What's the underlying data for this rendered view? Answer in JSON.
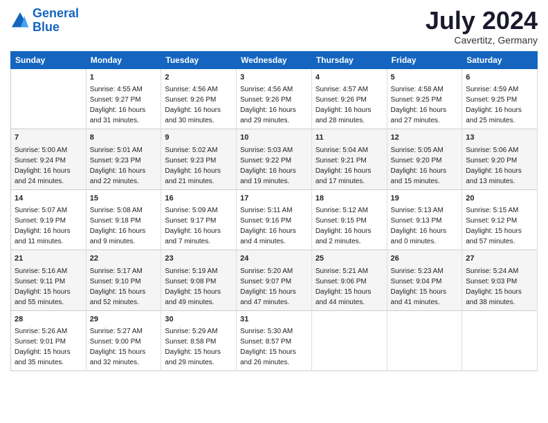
{
  "header": {
    "logo_line1": "General",
    "logo_line2": "Blue",
    "title": "July 2024",
    "subtitle": "Cavertitz, Germany"
  },
  "weekdays": [
    "Sunday",
    "Monday",
    "Tuesday",
    "Wednesday",
    "Thursday",
    "Friday",
    "Saturday"
  ],
  "weeks": [
    [
      {
        "day": "",
        "content": ""
      },
      {
        "day": "1",
        "content": "Sunrise: 4:55 AM\nSunset: 9:27 PM\nDaylight: 16 hours\nand 31 minutes."
      },
      {
        "day": "2",
        "content": "Sunrise: 4:56 AM\nSunset: 9:26 PM\nDaylight: 16 hours\nand 30 minutes."
      },
      {
        "day": "3",
        "content": "Sunrise: 4:56 AM\nSunset: 9:26 PM\nDaylight: 16 hours\nand 29 minutes."
      },
      {
        "day": "4",
        "content": "Sunrise: 4:57 AM\nSunset: 9:26 PM\nDaylight: 16 hours\nand 28 minutes."
      },
      {
        "day": "5",
        "content": "Sunrise: 4:58 AM\nSunset: 9:25 PM\nDaylight: 16 hours\nand 27 minutes."
      },
      {
        "day": "6",
        "content": "Sunrise: 4:59 AM\nSunset: 9:25 PM\nDaylight: 16 hours\nand 25 minutes."
      }
    ],
    [
      {
        "day": "7",
        "content": "Sunrise: 5:00 AM\nSunset: 9:24 PM\nDaylight: 16 hours\nand 24 minutes."
      },
      {
        "day": "8",
        "content": "Sunrise: 5:01 AM\nSunset: 9:23 PM\nDaylight: 16 hours\nand 22 minutes."
      },
      {
        "day": "9",
        "content": "Sunrise: 5:02 AM\nSunset: 9:23 PM\nDaylight: 16 hours\nand 21 minutes."
      },
      {
        "day": "10",
        "content": "Sunrise: 5:03 AM\nSunset: 9:22 PM\nDaylight: 16 hours\nand 19 minutes."
      },
      {
        "day": "11",
        "content": "Sunrise: 5:04 AM\nSunset: 9:21 PM\nDaylight: 16 hours\nand 17 minutes."
      },
      {
        "day": "12",
        "content": "Sunrise: 5:05 AM\nSunset: 9:20 PM\nDaylight: 16 hours\nand 15 minutes."
      },
      {
        "day": "13",
        "content": "Sunrise: 5:06 AM\nSunset: 9:20 PM\nDaylight: 16 hours\nand 13 minutes."
      }
    ],
    [
      {
        "day": "14",
        "content": "Sunrise: 5:07 AM\nSunset: 9:19 PM\nDaylight: 16 hours\nand 11 minutes."
      },
      {
        "day": "15",
        "content": "Sunrise: 5:08 AM\nSunset: 9:18 PM\nDaylight: 16 hours\nand 9 minutes."
      },
      {
        "day": "16",
        "content": "Sunrise: 5:09 AM\nSunset: 9:17 PM\nDaylight: 16 hours\nand 7 minutes."
      },
      {
        "day": "17",
        "content": "Sunrise: 5:11 AM\nSunset: 9:16 PM\nDaylight: 16 hours\nand 4 minutes."
      },
      {
        "day": "18",
        "content": "Sunrise: 5:12 AM\nSunset: 9:15 PM\nDaylight: 16 hours\nand 2 minutes."
      },
      {
        "day": "19",
        "content": "Sunrise: 5:13 AM\nSunset: 9:13 PM\nDaylight: 16 hours\nand 0 minutes."
      },
      {
        "day": "20",
        "content": "Sunrise: 5:15 AM\nSunset: 9:12 PM\nDaylight: 15 hours\nand 57 minutes."
      }
    ],
    [
      {
        "day": "21",
        "content": "Sunrise: 5:16 AM\nSunset: 9:11 PM\nDaylight: 15 hours\nand 55 minutes."
      },
      {
        "day": "22",
        "content": "Sunrise: 5:17 AM\nSunset: 9:10 PM\nDaylight: 15 hours\nand 52 minutes."
      },
      {
        "day": "23",
        "content": "Sunrise: 5:19 AM\nSunset: 9:08 PM\nDaylight: 15 hours\nand 49 minutes."
      },
      {
        "day": "24",
        "content": "Sunrise: 5:20 AM\nSunset: 9:07 PM\nDaylight: 15 hours\nand 47 minutes."
      },
      {
        "day": "25",
        "content": "Sunrise: 5:21 AM\nSunset: 9:06 PM\nDaylight: 15 hours\nand 44 minutes."
      },
      {
        "day": "26",
        "content": "Sunrise: 5:23 AM\nSunset: 9:04 PM\nDaylight: 15 hours\nand 41 minutes."
      },
      {
        "day": "27",
        "content": "Sunrise: 5:24 AM\nSunset: 9:03 PM\nDaylight: 15 hours\nand 38 minutes."
      }
    ],
    [
      {
        "day": "28",
        "content": "Sunrise: 5:26 AM\nSunset: 9:01 PM\nDaylight: 15 hours\nand 35 minutes."
      },
      {
        "day": "29",
        "content": "Sunrise: 5:27 AM\nSunset: 9:00 PM\nDaylight: 15 hours\nand 32 minutes."
      },
      {
        "day": "30",
        "content": "Sunrise: 5:29 AM\nSunset: 8:58 PM\nDaylight: 15 hours\nand 29 minutes."
      },
      {
        "day": "31",
        "content": "Sunrise: 5:30 AM\nSunset: 8:57 PM\nDaylight: 15 hours\nand 26 minutes."
      },
      {
        "day": "",
        "content": ""
      },
      {
        "day": "",
        "content": ""
      },
      {
        "day": "",
        "content": ""
      }
    ]
  ]
}
